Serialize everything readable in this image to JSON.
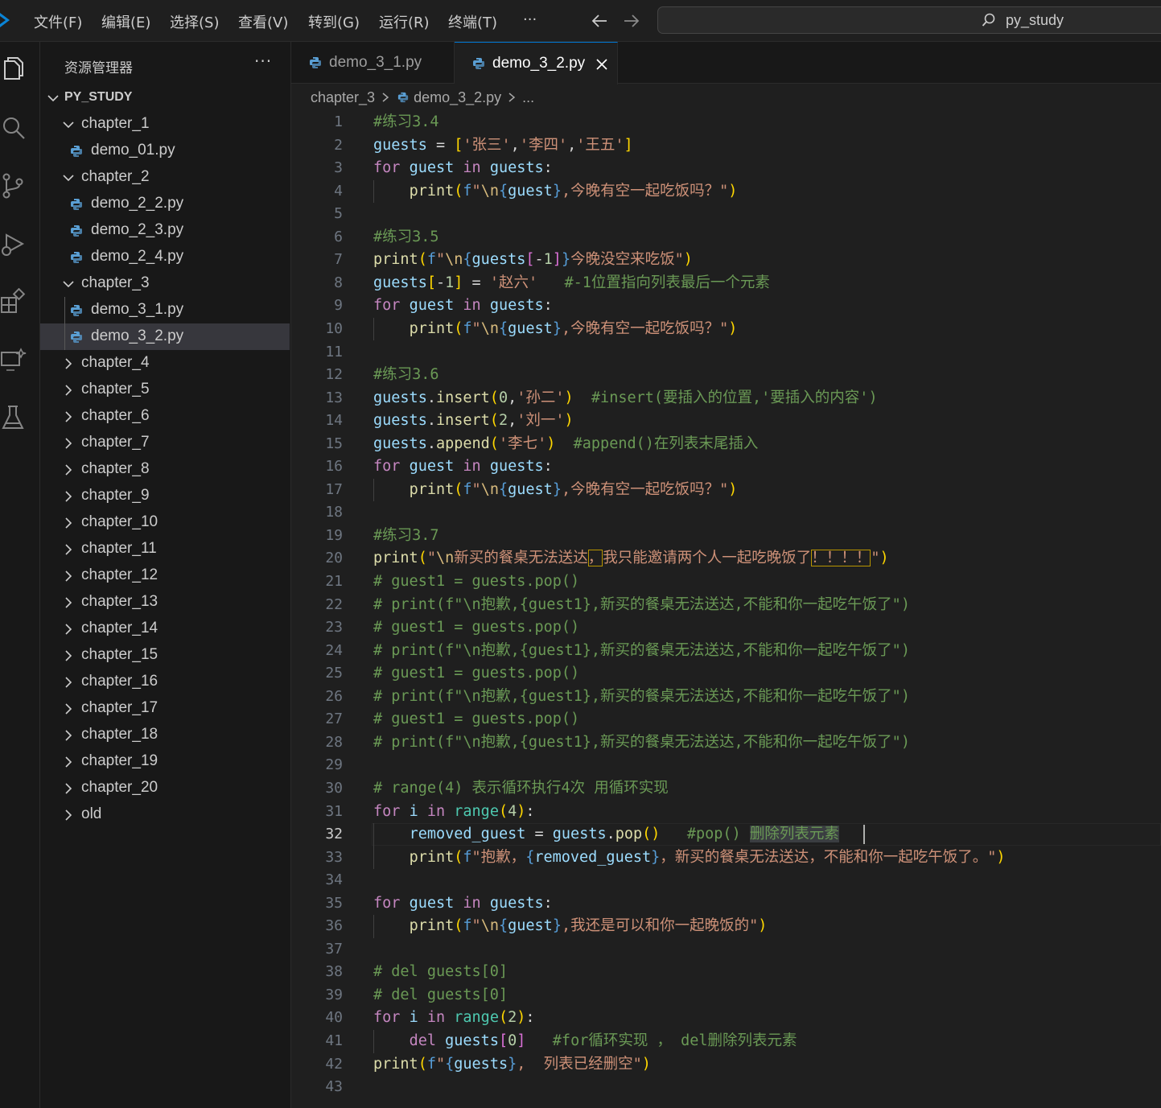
{
  "menu": [
    "文件(F)",
    "编辑(E)",
    "选择(S)",
    "查看(V)",
    "转到(G)",
    "运行(R)",
    "终端(T)",
    "···"
  ],
  "search": {
    "text": "py_study"
  },
  "sidebar": {
    "title": "资源管理器",
    "more": "···",
    "root": "PY_STUDY",
    "tree": [
      {
        "label": "chapter_1",
        "type": "folder",
        "open": true
      },
      {
        "label": "demo_01.py",
        "type": "file"
      },
      {
        "label": "chapter_2",
        "type": "folder",
        "open": true
      },
      {
        "label": "demo_2_2.py",
        "type": "file"
      },
      {
        "label": "demo_2_3.py",
        "type": "file"
      },
      {
        "label": "demo_2_4.py",
        "type": "file"
      },
      {
        "label": "chapter_3",
        "type": "folder",
        "open": true
      },
      {
        "label": "demo_3_1.py",
        "type": "file"
      },
      {
        "label": "demo_3_2.py",
        "type": "file",
        "selected": true
      },
      {
        "label": "chapter_4",
        "type": "folder"
      },
      {
        "label": "chapter_5",
        "type": "folder"
      },
      {
        "label": "chapter_6",
        "type": "folder"
      },
      {
        "label": "chapter_7",
        "type": "folder"
      },
      {
        "label": "chapter_8",
        "type": "folder"
      },
      {
        "label": "chapter_9",
        "type": "folder"
      },
      {
        "label": "chapter_10",
        "type": "folder"
      },
      {
        "label": "chapter_11",
        "type": "folder"
      },
      {
        "label": "chapter_12",
        "type": "folder"
      },
      {
        "label": "chapter_13",
        "type": "folder"
      },
      {
        "label": "chapter_14",
        "type": "folder"
      },
      {
        "label": "chapter_15",
        "type": "folder"
      },
      {
        "label": "chapter_16",
        "type": "folder"
      },
      {
        "label": "chapter_17",
        "type": "folder"
      },
      {
        "label": "chapter_18",
        "type": "folder"
      },
      {
        "label": "chapter_19",
        "type": "folder"
      },
      {
        "label": "chapter_20",
        "type": "folder"
      },
      {
        "label": "old",
        "type": "folder"
      }
    ]
  },
  "tabs": [
    {
      "label": "demo_3_1.py",
      "active": false
    },
    {
      "label": "demo_3_2.py",
      "active": true
    }
  ],
  "breadcrumb": [
    "chapter_3",
    "demo_3_2.py",
    "..."
  ],
  "editor": {
    "active_line": 32,
    "lines": [
      [
        [
          "c",
          "#练习3.4"
        ]
      ],
      [
        [
          "v",
          "guests"
        ],
        [
          "o",
          " = "
        ],
        [
          "p",
          "["
        ],
        [
          "s",
          "'张三'"
        ],
        [
          "o",
          ","
        ],
        [
          "s",
          "'李四'"
        ],
        [
          "o",
          ","
        ],
        [
          "s",
          "'王五'"
        ],
        [
          "p",
          "]"
        ]
      ],
      [
        [
          "k",
          "for"
        ],
        [
          "o",
          " "
        ],
        [
          "v",
          "guest"
        ],
        [
          "o",
          " "
        ],
        [
          "k",
          "in"
        ],
        [
          "o",
          " "
        ],
        [
          "v",
          "guests"
        ],
        [
          "o",
          ":"
        ]
      ],
      [
        [
          "o",
          "    "
        ],
        [
          "f",
          "print"
        ],
        [
          "p",
          "("
        ],
        [
          "fs",
          "f"
        ],
        [
          "s",
          "\""
        ],
        [
          "e",
          "\\n"
        ],
        [
          "cb",
          "{"
        ],
        [
          "v",
          "guest"
        ],
        [
          "cb",
          "}"
        ],
        [
          "s",
          ",今晚有空一起吃饭吗？\""
        ],
        [
          "p",
          ")"
        ]
      ],
      [],
      [
        [
          "c",
          "#练习3.5"
        ]
      ],
      [
        [
          "f",
          "print"
        ],
        [
          "p",
          "("
        ],
        [
          "fs",
          "f"
        ],
        [
          "s",
          "\""
        ],
        [
          "e",
          "\\n"
        ],
        [
          "cb",
          "{"
        ],
        [
          "v",
          "guests"
        ],
        [
          "p2",
          "["
        ],
        [
          "o",
          "-"
        ],
        [
          "n",
          "1"
        ],
        [
          "p2",
          "]"
        ],
        [
          "cb",
          "}"
        ],
        [
          "s",
          "今晚没空来吃饭\""
        ],
        [
          "p",
          ")"
        ]
      ],
      [
        [
          "v",
          "guests"
        ],
        [
          "p",
          "["
        ],
        [
          "o",
          "-"
        ],
        [
          "n",
          "1"
        ],
        [
          "p",
          "]"
        ],
        [
          "o",
          " = "
        ],
        [
          "s",
          "'赵六'"
        ],
        [
          "o",
          "   "
        ],
        [
          "c",
          "#-1位置指向列表最后一个元素"
        ]
      ],
      [
        [
          "k",
          "for"
        ],
        [
          "o",
          " "
        ],
        [
          "v",
          "guest"
        ],
        [
          "o",
          " "
        ],
        [
          "k",
          "in"
        ],
        [
          "o",
          " "
        ],
        [
          "v",
          "guests"
        ],
        [
          "o",
          ":"
        ]
      ],
      [
        [
          "o",
          "    "
        ],
        [
          "f",
          "print"
        ],
        [
          "p",
          "("
        ],
        [
          "fs",
          "f"
        ],
        [
          "s",
          "\""
        ],
        [
          "e",
          "\\n"
        ],
        [
          "cb",
          "{"
        ],
        [
          "v",
          "guest"
        ],
        [
          "cb",
          "}"
        ],
        [
          "s",
          ",今晚有空一起吃饭吗？\""
        ],
        [
          "p",
          ")"
        ]
      ],
      [],
      [
        [
          "c",
          "#练习3.6"
        ]
      ],
      [
        [
          "v",
          "guests"
        ],
        [
          "o",
          "."
        ],
        [
          "f",
          "insert"
        ],
        [
          "p",
          "("
        ],
        [
          "n",
          "0"
        ],
        [
          "o",
          ","
        ],
        [
          "s",
          "'孙二'"
        ],
        [
          "p",
          ")"
        ],
        [
          "o",
          "  "
        ],
        [
          "c",
          "#insert(要插入的位置,'要插入的内容')"
        ]
      ],
      [
        [
          "v",
          "guests"
        ],
        [
          "o",
          "."
        ],
        [
          "f",
          "insert"
        ],
        [
          "p",
          "("
        ],
        [
          "n",
          "2"
        ],
        [
          "o",
          ","
        ],
        [
          "s",
          "'刘一'"
        ],
        [
          "p",
          ")"
        ]
      ],
      [
        [
          "v",
          "guests"
        ],
        [
          "o",
          "."
        ],
        [
          "f",
          "append"
        ],
        [
          "p",
          "("
        ],
        [
          "s",
          "'李七'"
        ],
        [
          "p",
          ")"
        ],
        [
          "o",
          "  "
        ],
        [
          "c",
          "#append()在列表末尾插入"
        ]
      ],
      [
        [
          "k",
          "for"
        ],
        [
          "o",
          " "
        ],
        [
          "v",
          "guest"
        ],
        [
          "o",
          " "
        ],
        [
          "k",
          "in"
        ],
        [
          "o",
          " "
        ],
        [
          "v",
          "guests"
        ],
        [
          "o",
          ":"
        ]
      ],
      [
        [
          "o",
          "    "
        ],
        [
          "f",
          "print"
        ],
        [
          "p",
          "("
        ],
        [
          "fs",
          "f"
        ],
        [
          "s",
          "\""
        ],
        [
          "e",
          "\\n"
        ],
        [
          "cb",
          "{"
        ],
        [
          "v",
          "guest"
        ],
        [
          "cb",
          "}"
        ],
        [
          "s",
          ",今晚有空一起吃饭吗？\""
        ],
        [
          "p",
          ")"
        ]
      ],
      [],
      [
        [
          "c",
          "#练习3.7"
        ]
      ],
      [
        [
          "f",
          "print"
        ],
        [
          "p",
          "("
        ],
        [
          "s",
          "\""
        ],
        [
          "e",
          "\\n"
        ],
        [
          "s",
          "新买的餐桌无法送达"
        ],
        [
          "sw",
          "，"
        ],
        [
          "s",
          "我只能邀请两个人一起吃晚饭了"
        ],
        [
          "sw",
          "！！！！"
        ],
        [
          "s",
          "\""
        ],
        [
          "p",
          ")"
        ]
      ],
      [
        [
          "c",
          "# guest1 = guests.pop()"
        ]
      ],
      [
        [
          "c",
          "# print(f\"\\n抱歉,{guest1},新买的餐桌无法送达,不能和你一起吃午饭了\")"
        ]
      ],
      [
        [
          "c",
          "# guest1 = guests.pop()"
        ]
      ],
      [
        [
          "c",
          "# print(f\"\\n抱歉,{guest1},新买的餐桌无法送达,不能和你一起吃午饭了\")"
        ]
      ],
      [
        [
          "c",
          "# guest1 = guests.pop()"
        ]
      ],
      [
        [
          "c",
          "# print(f\"\\n抱歉,{guest1},新买的餐桌无法送达,不能和你一起吃午饭了\")"
        ]
      ],
      [
        [
          "c",
          "# guest1 = guests.pop()"
        ]
      ],
      [
        [
          "c",
          "# print(f\"\\n抱歉,{guest1},新买的餐桌无法送达,不能和你一起吃午饭了\")"
        ]
      ],
      [],
      [
        [
          "c",
          "# range(4) 表示循环执行4次 用循环实现"
        ]
      ],
      [
        [
          "k",
          "for"
        ],
        [
          "o",
          " "
        ],
        [
          "v",
          "i"
        ],
        [
          "o",
          " "
        ],
        [
          "k",
          "in"
        ],
        [
          "o",
          " "
        ],
        [
          "tc",
          "range"
        ],
        [
          "p",
          "("
        ],
        [
          "n",
          "4"
        ],
        [
          "p",
          ")"
        ],
        [
          "o",
          ":"
        ]
      ],
      [
        [
          "o",
          "    "
        ],
        [
          "v",
          "removed_guest"
        ],
        [
          "o",
          " = "
        ],
        [
          "v",
          "guests"
        ],
        [
          "o",
          "."
        ],
        [
          "f",
          "pop"
        ],
        [
          "p",
          "()"
        ],
        [
          "o",
          "   "
        ],
        [
          "c",
          "#pop() "
        ],
        [
          "cs",
          "删除列表元素"
        ]
      ],
      [
        [
          "o",
          "    "
        ],
        [
          "f",
          "print"
        ],
        [
          "p",
          "("
        ],
        [
          "fs",
          "f"
        ],
        [
          "s",
          "\"抱歉，"
        ],
        [
          "cb",
          "{"
        ],
        [
          "v",
          "removed_guest"
        ],
        [
          "cb",
          "}"
        ],
        [
          "s",
          "，新买的餐桌无法送达，不能和你一起吃午饭了。\""
        ],
        [
          "p",
          ")"
        ]
      ],
      [],
      [
        [
          "k",
          "for"
        ],
        [
          "o",
          " "
        ],
        [
          "v",
          "guest"
        ],
        [
          "o",
          " "
        ],
        [
          "k",
          "in"
        ],
        [
          "o",
          " "
        ],
        [
          "v",
          "guests"
        ],
        [
          "o",
          ":"
        ]
      ],
      [
        [
          "o",
          "    "
        ],
        [
          "f",
          "print"
        ],
        [
          "p",
          "("
        ],
        [
          "fs",
          "f"
        ],
        [
          "s",
          "\""
        ],
        [
          "e",
          "\\n"
        ],
        [
          "cb",
          "{"
        ],
        [
          "v",
          "guest"
        ],
        [
          "cb",
          "}"
        ],
        [
          "s",
          ",我还是可以和你一起晚饭的\""
        ],
        [
          "p",
          ")"
        ]
      ],
      [],
      [
        [
          "c",
          "# del guests[0]"
        ]
      ],
      [
        [
          "c",
          "# del guests[0]"
        ]
      ],
      [
        [
          "k",
          "for"
        ],
        [
          "o",
          " "
        ],
        [
          "v",
          "i"
        ],
        [
          "o",
          " "
        ],
        [
          "k",
          "in"
        ],
        [
          "o",
          " "
        ],
        [
          "tc",
          "range"
        ],
        [
          "p",
          "("
        ],
        [
          "n",
          "2"
        ],
        [
          "p",
          ")"
        ],
        [
          "o",
          ":"
        ]
      ],
      [
        [
          "o",
          "    "
        ],
        [
          "k",
          "del"
        ],
        [
          "o",
          " "
        ],
        [
          "v",
          "guests"
        ],
        [
          "p2",
          "["
        ],
        [
          "n",
          "0"
        ],
        [
          "p2",
          "]"
        ],
        [
          "o",
          "   "
        ],
        [
          "c",
          "#for循环实现 ， del删除列表元素"
        ]
      ],
      [
        [
          "f",
          "print"
        ],
        [
          "p",
          "("
        ],
        [
          "fs",
          "f"
        ],
        [
          "s",
          "\""
        ],
        [
          "cb",
          "{"
        ],
        [
          "v",
          "guests"
        ],
        [
          "cb",
          "}"
        ],
        [
          "s",
          ",  列表已经删空\""
        ],
        [
          "p",
          ")"
        ]
      ],
      []
    ]
  },
  "colors": {
    "accent": "#0078d4",
    "selected_row": "#37373d",
    "warning_box": "#b89500"
  }
}
